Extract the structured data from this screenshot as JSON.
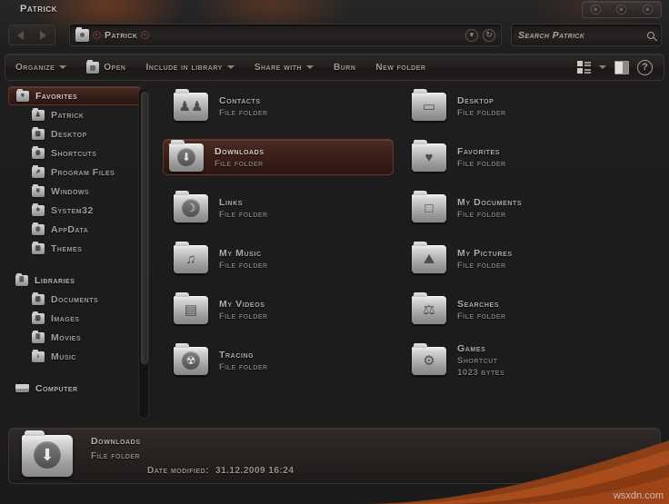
{
  "window": {
    "title": "Patrick",
    "controls": [
      "minimize",
      "maximize",
      "close"
    ]
  },
  "nav": {
    "back_label": "Back",
    "forward_label": "Forward",
    "breadcrumb": "Patrick",
    "history_icon": "chevron-down-icon",
    "refresh_icon": "refresh-icon"
  },
  "search": {
    "placeholder": "Search Patrick",
    "value": "",
    "icon": "search-icon"
  },
  "toolbar": {
    "items": [
      {
        "label": "Organize",
        "caret": true,
        "icon": null
      },
      {
        "label": "Open",
        "caret": false,
        "icon": "folder-open-icon"
      },
      {
        "label": "Include in library",
        "caret": true,
        "icon": null
      },
      {
        "label": "Share with",
        "caret": true,
        "icon": null
      },
      {
        "label": "Burn",
        "caret": false,
        "icon": null
      },
      {
        "label": "New folder",
        "caret": false,
        "icon": null
      }
    ],
    "view_icon": "view-options-icon",
    "view_caret": true,
    "preview_icon": "preview-pane-icon",
    "help_icon": "help-icon",
    "help_glyph": "?"
  },
  "sidebar": {
    "groups": [
      {
        "header": {
          "label": "Favorites",
          "icon": "favorites-folder-icon",
          "glyph": "♥",
          "selected": true
        },
        "items": [
          {
            "label": "Patrick",
            "icon": "user-folder-icon",
            "glyph": "♟"
          },
          {
            "label": "Desktop",
            "icon": "desktop-folder-icon",
            "glyph": "▣"
          },
          {
            "label": "Shortcuts",
            "icon": "shortcut-folder-icon",
            "glyph": "◉"
          },
          {
            "label": "Program Files",
            "icon": "program-folder-icon",
            "glyph": "↗"
          },
          {
            "label": "Windows",
            "icon": "windows-folder-icon",
            "glyph": "✕"
          },
          {
            "label": "System32",
            "icon": "system-folder-icon",
            "glyph": "✦"
          },
          {
            "label": "AppData",
            "icon": "appdata-folder-icon",
            "glyph": "◎"
          },
          {
            "label": "Themes",
            "icon": "themes-folder-icon",
            "glyph": "▤"
          }
        ]
      },
      {
        "header": {
          "label": "Libraries",
          "icon": "libraries-folder-icon",
          "glyph": "☰",
          "selected": false
        },
        "items": [
          {
            "label": "Documents",
            "icon": "documents-folder-icon",
            "glyph": "▧"
          },
          {
            "label": "Images",
            "icon": "images-folder-icon",
            "glyph": "▦"
          },
          {
            "label": "Movies",
            "icon": "movies-folder-icon",
            "glyph": "☰"
          },
          {
            "label": "Music",
            "icon": "music-folder-icon",
            "glyph": "♪"
          }
        ]
      },
      {
        "header": {
          "label": "Computer",
          "icon": "computer-drive-icon",
          "glyph": "",
          "selected": false
        },
        "items": []
      }
    ],
    "scrollbar": {
      "name": "sidebar-scrollbar"
    }
  },
  "files": {
    "left_column": [
      {
        "name": "Contacts",
        "type": "File folder",
        "size": "",
        "icon": "contacts-folder-icon",
        "glyph": "♟♟",
        "style": "sym",
        "selected": false
      },
      {
        "name": "Downloads",
        "type": "File folder",
        "size": "",
        "icon": "downloads-folder-icon",
        "glyph": "⬇",
        "style": "disc",
        "selected": true
      },
      {
        "name": "Links",
        "type": "File folder",
        "size": "",
        "icon": "links-folder-icon",
        "glyph": "⊕",
        "style": "disc",
        "selected": false
      },
      {
        "name": "My Music",
        "type": "File folder",
        "size": "",
        "icon": "music-folder-icon",
        "glyph": "♫",
        "style": "sym",
        "selected": false
      },
      {
        "name": "My Videos",
        "type": "File folder",
        "size": "",
        "icon": "videos-folder-icon",
        "glyph": "▤",
        "style": "sym",
        "selected": false
      },
      {
        "name": "Tracing",
        "type": "File folder",
        "size": "",
        "icon": "tracing-folder-icon",
        "glyph": "☢",
        "style": "disc",
        "selected": false
      }
    ],
    "right_column": [
      {
        "name": "Desktop",
        "type": "File folder",
        "size": "",
        "icon": "desktop-folder-icon",
        "glyph": "▭",
        "style": "sym",
        "selected": false
      },
      {
        "name": "Favorites",
        "type": "File folder",
        "size": "",
        "icon": "favorites-folder-icon",
        "glyph": "♥",
        "style": "sym",
        "selected": false
      },
      {
        "name": "My Documents",
        "type": "File folder",
        "size": "",
        "icon": "documents-folder-icon",
        "glyph": "▱",
        "style": "sym",
        "selected": false
      },
      {
        "name": "My Pictures",
        "type": "File folder",
        "size": "",
        "icon": "pictures-folder-icon",
        "glyph": "⛰",
        "style": "sym",
        "selected": false
      },
      {
        "name": "Searches",
        "type": "File folder",
        "size": "",
        "icon": "searches-folder-icon",
        "glyph": "☖",
        "style": "sym",
        "selected": false
      },
      {
        "name": "Games",
        "type": "Shortcut",
        "size": "1023 bytes",
        "icon": "games-folder-icon",
        "glyph": "⚙",
        "style": "sym",
        "selected": false
      }
    ]
  },
  "details": {
    "name": "Downloads",
    "type": "File folder",
    "date_label": "Date modified:",
    "date_value": "31.12.2009 16:24",
    "icon": "downloads-folder-icon"
  },
  "watermark": {
    "text": "wsxdn.com"
  },
  "colors": {
    "background": "#1b1b1b",
    "selection": "#4d2b22",
    "selection_border": "#64382c",
    "accent_glow": "#b8551e",
    "text_primary": "#b5aeaa",
    "text_secondary": "#7f7874"
  }
}
